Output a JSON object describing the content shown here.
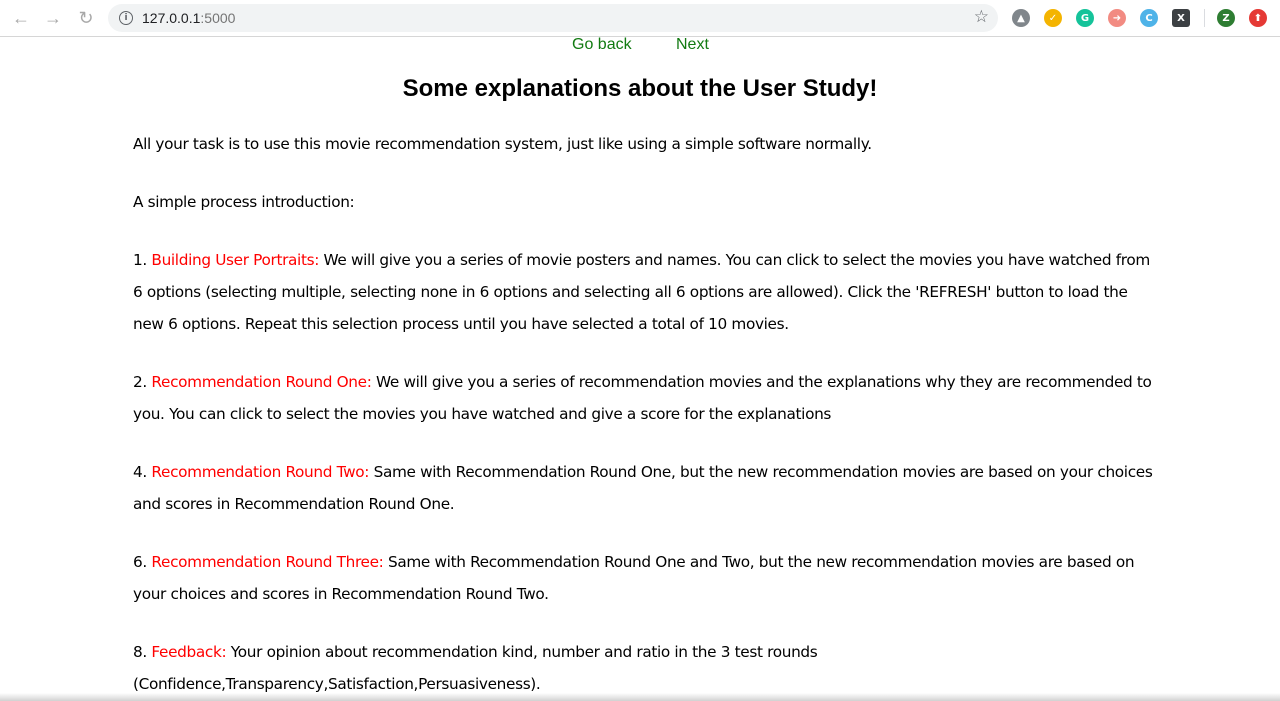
{
  "browser": {
    "url_host": "127.0.0.1",
    "url_port": ":5000",
    "extensions": [
      {
        "name": "drive-icon",
        "color": "#80868b",
        "glyph": "▲"
      },
      {
        "name": "chrome-ext-icon",
        "color": "#f4b400",
        "glyph": "✓"
      },
      {
        "name": "grammarly-icon",
        "color": "#15c39a",
        "glyph": "G"
      },
      {
        "name": "share-ext-icon",
        "color": "#f28b82",
        "glyph": "➜"
      },
      {
        "name": "ext-badge-icon",
        "color": "#4fb3e8",
        "glyph": "C"
      },
      {
        "name": "x-ext-icon",
        "color": "#3c4043",
        "glyph": "X"
      },
      {
        "name": "profile-avatar",
        "color": "#2e7d32",
        "glyph": "Z"
      },
      {
        "name": "update-icon",
        "color": "#e53935",
        "glyph": "⬆"
      }
    ]
  },
  "nav": {
    "back_label": "Go back",
    "next_label": "Next"
  },
  "title": "Some explanations about the User Study!",
  "intro": "All your task is to use this movie recommendation system, just like using a simple software normally.",
  "process_intro": "A simple process introduction:",
  "steps": [
    {
      "number": "1.",
      "heading": "Building User Portraits:",
      "text": "We will give you a series of movie posters and names. You can click to select the movies you have watched from 6 options (selecting multiple, selecting none in 6 options and selecting all 6 options are allowed). Click the 'REFRESH' button to load the new 6 options. Repeat this selection process until you have selected a total of 10 movies."
    },
    {
      "number": "2.",
      "heading": "Recommendation Round One:",
      "text": "We will give you a series of recommendation movies and the explanations why they are recommended to you. You can click to select the movies you have watched and give a score for the explanations"
    },
    {
      "number": "4.",
      "heading": "Recommendation Round Two:",
      "text": "Same with Recommendation Round One, but the new recommendation movies are based on your choices and scores in Recommendation Round One."
    },
    {
      "number": "6.",
      "heading": "Recommendation Round Three:",
      "text": "Same with Recommendation Round One and Two, but the new recommendation movies are based on your choices and scores in Recommendation Round Two."
    },
    {
      "number": "8.",
      "heading": "Feedback:",
      "text": "Your opinion about recommendation kind, number and ratio in the 3 test rounds (Confidence,Transparency,Satisfaction,Persuasiveness)."
    }
  ],
  "colors": {
    "link": "#117a11",
    "highlight": "#ff0000"
  }
}
